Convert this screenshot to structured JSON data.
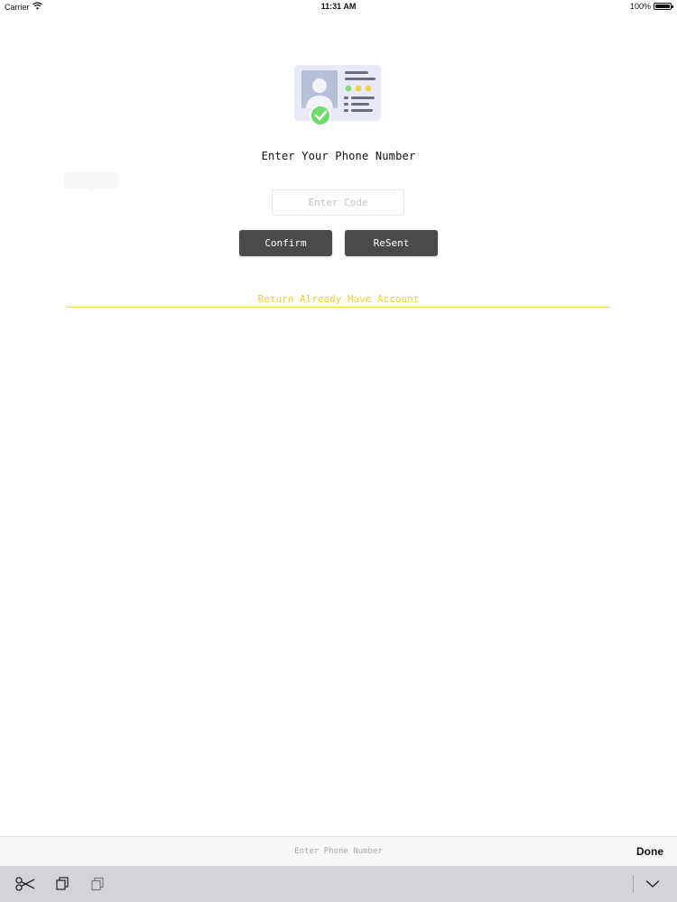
{
  "status_bar": {
    "carrier": "Carrier",
    "time": "11:31 AM",
    "battery": "100%",
    "battery_level": 1.0
  },
  "main": {
    "title": "Enter Your Phone Number",
    "code_input": {
      "placeholder": "Enter Code",
      "value": ""
    },
    "confirm_label": "Confirm",
    "resent_label": "ReSent",
    "return_link": "Return Already Have Account"
  },
  "accessory_bar": {
    "field_placeholder": "Enter Phone Number",
    "done_label": "Done"
  },
  "keyboard_toolbar": {
    "icons": [
      "scissors-icon",
      "copy-icon",
      "paste-icon",
      "chevron-down-icon"
    ]
  },
  "colors": {
    "button_bg": "#4a4a4c",
    "link": "#f1cf2c",
    "illustration_bg": "#e8eaf6",
    "check_green": "#6fdb6a",
    "dot_green": "#7bd97a",
    "dot_yellow": "#f3cf3c"
  }
}
